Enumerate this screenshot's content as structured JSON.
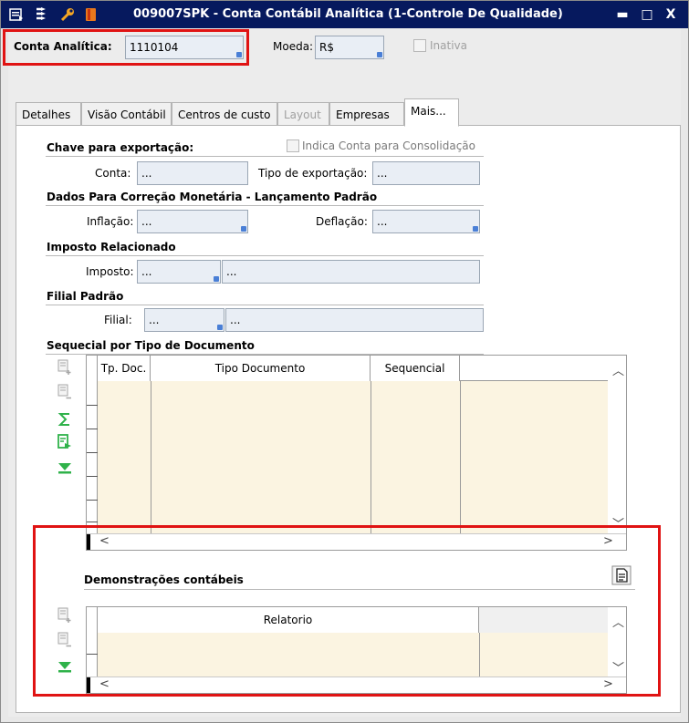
{
  "window": {
    "title": "009007SPK - Conta Contábil Analítica (1-Controle De Qualidade)",
    "minimize": "▬",
    "maximize": "□",
    "close": "X"
  },
  "header": {
    "conta_label": "Conta Analítica:",
    "conta_value": "1110104",
    "moeda_label": "Moeda:",
    "moeda_value": "R$",
    "inativa_label": "Inativa"
  },
  "tabs": [
    {
      "label": "Detalhes",
      "state": "normal"
    },
    {
      "label": "Visão Contábil",
      "state": "normal"
    },
    {
      "label": "Centros de custo",
      "state": "normal"
    },
    {
      "label": "Layout",
      "state": "disabled"
    },
    {
      "label": "Empresas",
      "state": "normal"
    },
    {
      "label": "Mais...",
      "state": "active"
    }
  ],
  "mais": {
    "chave_title": "Chave para exportação:",
    "consolidacao_label": "Indica Conta para Consolidação",
    "conta_label": "Conta:",
    "conta_value": "...",
    "tipo_export_label": "Tipo de exportação:",
    "tipo_export_value": "...",
    "correcao_title": "Dados Para Correção Monetária - Lançamento Padrão",
    "inflacao_label": "Inflação:",
    "inflacao_value": "...",
    "deflacao_label": "Deflação:",
    "deflacao_value": "...",
    "imposto_title": "Imposto Relacionado",
    "imposto_label": "Imposto:",
    "imposto_code": "...",
    "imposto_desc": "...",
    "filial_title": "Filial Padrão",
    "filial_label": "Filial:",
    "filial_code": "...",
    "filial_desc": "...",
    "seq_title": "Sequecial por Tipo de Documento",
    "seq_columns": [
      "Tp. Doc.",
      "Tipo Documento",
      "Sequencial"
    ],
    "demo_title": "Demonstrações contábeis",
    "demo_columns": [
      "Relatorio"
    ]
  },
  "colors": {
    "titlebar": "#06195e",
    "highlight": "#e01313",
    "grid_bg": "#fbf4e1",
    "tool_green": "#2fb24a"
  }
}
